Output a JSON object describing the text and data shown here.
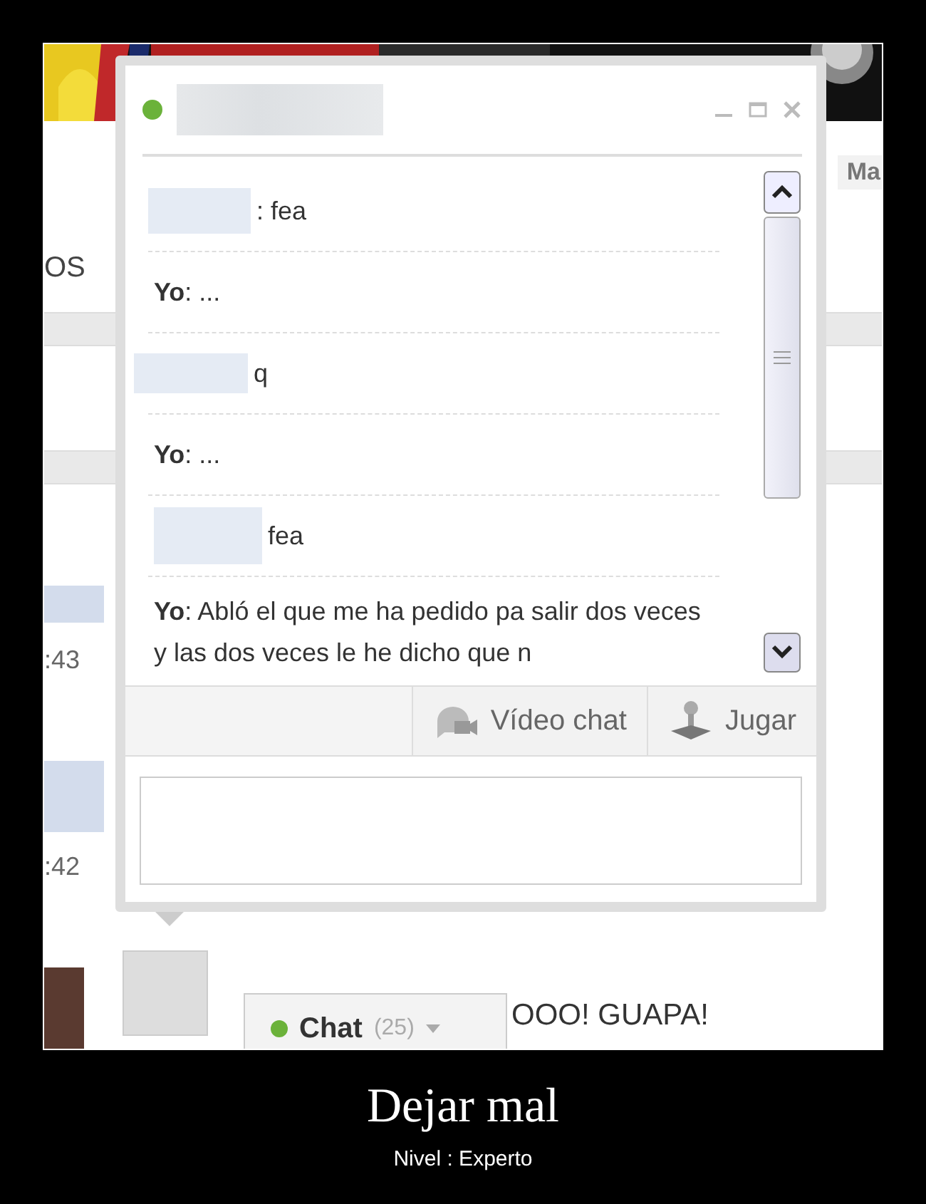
{
  "poster": {
    "title": "Dejar mal",
    "subtitle": "Nivel : Experto"
  },
  "background_page": {
    "top_right_link": "Ma",
    "left_heading": "OS",
    "times": [
      ":43",
      ":42"
    ],
    "post_text": "OOO! GUAPA!",
    "chat_tab": {
      "label": "Chat",
      "count": "(25)",
      "online": true
    }
  },
  "chat_window": {
    "online": true,
    "messages": [
      {
        "kind": "redacted",
        "text": ": fea"
      },
      {
        "kind": "named",
        "sender": "Yo",
        "text": ": ..."
      },
      {
        "kind": "redacted",
        "text": "q"
      },
      {
        "kind": "named",
        "sender": "Yo",
        "text": ": ..."
      },
      {
        "kind": "redacted",
        "text": "fea"
      },
      {
        "kind": "named",
        "sender": "Yo",
        "text": ": Abló el que me ha pedido pa salir dos veces y las dos veces le he dicho que n"
      }
    ],
    "actions": [
      {
        "kind": "video",
        "label": "Vídeo chat"
      },
      {
        "kind": "game",
        "label": "Jugar"
      }
    ]
  }
}
